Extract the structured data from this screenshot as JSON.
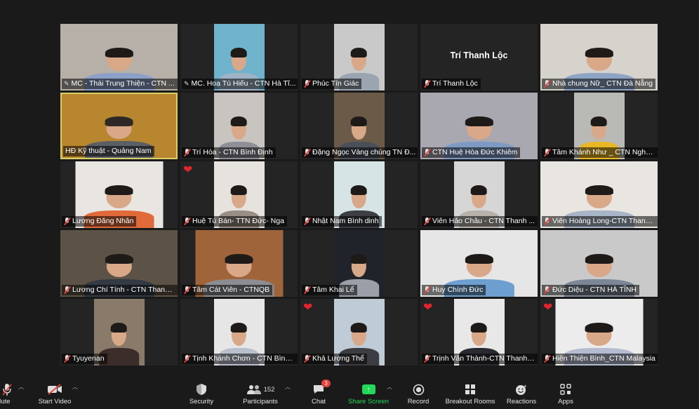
{
  "participants": [
    {
      "name": "MC - Thái Trung Thiện - CTN ...",
      "pinned": true,
      "muted": false,
      "heart": false,
      "bg": "#b7b0a8",
      "body": "#8ca0c8",
      "hair": "#1e1a18",
      "vw": 167
    },
    {
      "name": "MC. Hoạ Tú Hiếu - CTN Hà Tĩ...",
      "pinned": true,
      "muted": false,
      "heart": false,
      "bg": "#6fb3cc",
      "body": "#9fb3c7",
      "hair": "#1e1a18",
      "vw": 72
    },
    {
      "name": "Phúc Tín Giác",
      "pinned": false,
      "muted": true,
      "heart": false,
      "bg": "#c9c9c9",
      "body": "#9aa5b1",
      "hair": "#1e1a18",
      "vw": 72
    },
    {
      "name": "Trí Thanh Lộc",
      "pinned": false,
      "muted": true,
      "heart": false,
      "bg": "#242424",
      "body": "",
      "hair": "",
      "vw": 0,
      "center_name": "Trí Thanh Lộc"
    },
    {
      "name": "Nhà chung Nữ_ CTN Đà Nẵng",
      "pinned": false,
      "muted": true,
      "heart": false,
      "bg": "#d6d2cc",
      "body": "#8ea4c4",
      "hair": "#1e1a18",
      "vw": 167
    },
    {
      "name": "HĐ Kỹ thuật - Quảng Nam",
      "pinned": false,
      "muted": false,
      "heart": false,
      "bg": "#b8862e",
      "body": "#5b5f66",
      "hair": "#2d2826",
      "vw": 167,
      "active": true
    },
    {
      "name": "Trí Hòa - CTN Bình Định",
      "pinned": false,
      "muted": true,
      "heart": false,
      "bg": "#c8c4bf",
      "body": "#8f8f98",
      "hair": "#1e1a18",
      "vw": 72
    },
    {
      "name": "Đặng Ngọc Vàng chúng TN Đ...",
      "pinned": false,
      "muted": true,
      "heart": false,
      "bg": "#6c5a48",
      "body": "#4a4f5a",
      "hair": "#1e1a18",
      "vw": 72
    },
    {
      "name": "CTN Huệ Hòa Đức Khiêm",
      "pinned": false,
      "muted": true,
      "heart": false,
      "bg": "#a9a7b0",
      "body": "#7e9ac4",
      "hair": "#1e1a18",
      "vw": 167
    },
    {
      "name": "Tâm Khánh Như _ CTN Nghệ ...",
      "pinned": false,
      "muted": true,
      "heart": false,
      "bg": "#b9b9b6",
      "body": "#e8b725",
      "hair": "#1e1a18",
      "vw": 72
    },
    {
      "name": "Lương Đăng Nhân",
      "pinned": false,
      "muted": true,
      "heart": false,
      "bg": "#e9e6e2",
      "body": "#e06a3a",
      "hair": "#1e1a18",
      "vw": 125
    },
    {
      "name": "Huệ Tú Bán- TTN Đức- Nga",
      "pinned": false,
      "muted": true,
      "heart": true,
      "bg": "#e6e3de",
      "body": "#9a8f86",
      "hair": "#1e1a18",
      "vw": 72
    },
    {
      "name": "Nhật Nam Bình dinh",
      "pinned": false,
      "muted": true,
      "heart": false,
      "bg": "#d7e4e6",
      "body": "#3d3f44",
      "hair": "#1e1a18",
      "vw": 72
    },
    {
      "name": "Viên Hảo Châu - CTN Thanh ...",
      "pinned": false,
      "muted": true,
      "heart": false,
      "bg": "#d6d6d6",
      "body": "#b7b1a9",
      "hair": "#1e1a18",
      "vw": 72
    },
    {
      "name": "Viên Hoàng Long-CTN Thanh ...",
      "pinned": false,
      "muted": true,
      "heart": false,
      "bg": "#e9e5e1",
      "body": "#a8b5c6",
      "hair": "#1e1a18",
      "vw": 167
    },
    {
      "name": "Lương Chí Tính - CTN Thanh ...",
      "pinned": false,
      "muted": true,
      "heart": false,
      "bg": "#5d5246",
      "body": "#333a44",
      "hair": "#1e1a18",
      "vw": 167
    },
    {
      "name": "Tâm Cát Viên - CTNQB",
      "pinned": false,
      "muted": true,
      "heart": false,
      "bg": "#a0643a",
      "body": "#8b8d92",
      "hair": "#1e1a18",
      "vw": 125
    },
    {
      "name": "Tâm Khai Lể",
      "pinned": false,
      "muted": true,
      "heart": false,
      "bg": "#20232a",
      "body": "#9a9fa8",
      "hair": "#1e1a18",
      "vw": 72
    },
    {
      "name": "Huy Chính Đức",
      "pinned": false,
      "muted": true,
      "heart": false,
      "bg": "#e6e6e6",
      "body": "#6e9fd0",
      "hair": "#1e1a18",
      "vw": 167
    },
    {
      "name": "Đức Diệu - CTN HÀ TĨNH",
      "pinned": false,
      "muted": true,
      "heart": false,
      "bg": "#c9c9c9",
      "body": "#7c8796",
      "hair": "#1e1a18",
      "vw": 167
    },
    {
      "name": "Tyuyenan",
      "pinned": false,
      "muted": true,
      "heart": false,
      "bg": "#8a7a6a",
      "body": "#3b2d2a",
      "hair": "#1e1a18",
      "vw": 72
    },
    {
      "name": "Tịnh Khánh Chơn - CTN Bình ...",
      "pinned": false,
      "muted": true,
      "heart": false,
      "bg": "#e6e6e6",
      "body": "#b9bfcc",
      "hair": "#1e1a18",
      "vw": 72
    },
    {
      "name": "Khả Lương Thể",
      "pinned": false,
      "muted": true,
      "heart": true,
      "bg": "#bfcbd7",
      "body": "#3c3d42",
      "hair": "#1e1a18",
      "vw": 72
    },
    {
      "name": "Trịnh Văn Thành-CTN Thanh H...",
      "pinned": false,
      "muted": true,
      "heart": true,
      "bg": "#e8e8e8",
      "body": "#2a2b30",
      "hair": "#1e1a18",
      "vw": 72
    },
    {
      "name": "Hiền Thiện Bình_CTN Malaysia",
      "pinned": false,
      "muted": true,
      "heart": true,
      "bg": "#ececec",
      "body": "#b5bcd1",
      "hair": "#1e1a18",
      "vw": 125
    }
  ],
  "toolbar": {
    "mute_label": "Mute",
    "start_video_label": "Start Video",
    "security_label": "Security",
    "participants_label": "Participants",
    "participants_count": "152",
    "chat_label": "Chat",
    "chat_badge": "3",
    "share_label": "Share Screen",
    "record_label": "Record",
    "breakout_label": "Breakout Rooms",
    "reactions_label": "Reactions",
    "apps_label": "Apps"
  },
  "colors": {
    "background": "#1a1a1a",
    "active_speaker_border": "#d9d066",
    "share_green": "#23d959",
    "muted_red": "#e5413b",
    "heart_red": "#e3242b"
  }
}
